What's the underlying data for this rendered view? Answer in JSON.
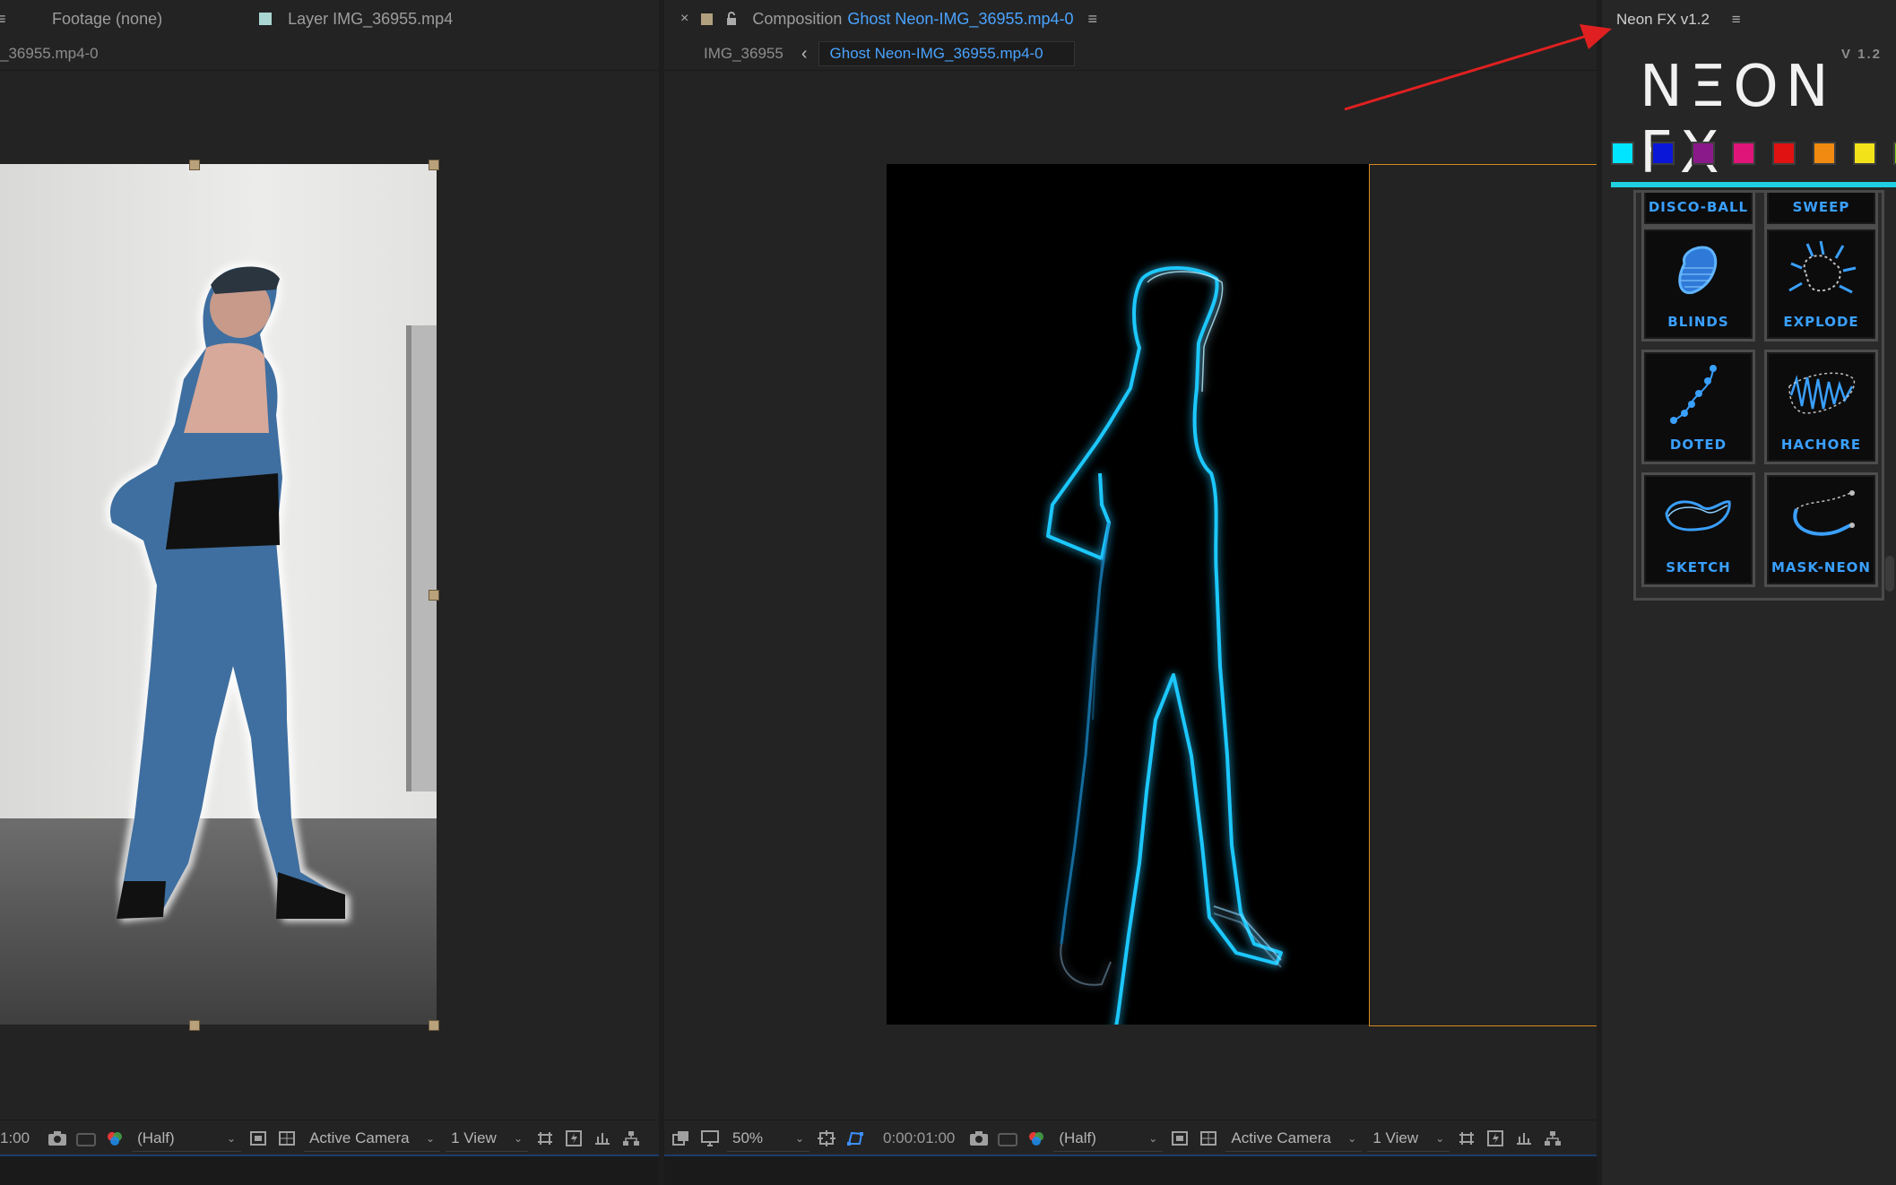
{
  "left_panel": {
    "tab_footage": "Footage  (none)",
    "tab_layer": "Layer  IMG_36955.mp4",
    "subtitle": "_36955.mp4-0",
    "footer_time": "1:00",
    "footer_resolution": "(Half)",
    "footer_camera": "Active Camera",
    "footer_view": "1 View"
  },
  "comp_panel": {
    "close": "×",
    "tab_prefix": "Composition",
    "tab_name": "Ghost Neon-IMG_36955.mp4-0",
    "breadcrumb_parent": "IMG_36955",
    "breadcrumb_arrow": "‹",
    "breadcrumb_current": "Ghost Neon-IMG_36955.mp4-0",
    "footer_zoom": "50%",
    "footer_time": "0:00:01:00",
    "footer_resolution": "(Half)",
    "footer_camera": "Active Camera",
    "footer_view": "1 View"
  },
  "neon_panel": {
    "title": "Neon FX v1.2",
    "logo": "NΞON FX",
    "version": "V 1.2",
    "swatches": [
      "#00e5ff",
      "#0a17d8",
      "#8a1a8a",
      "#e0157a",
      "#e01212",
      "#f08a10",
      "#f2e21a",
      "#7ccc12"
    ],
    "accent_color": "#1fd0e0",
    "effects": [
      {
        "label": "DISCO-BALL",
        "icon": "disco-ball-icon"
      },
      {
        "label": "SWEEP",
        "icon": "sweep-icon"
      },
      {
        "label": "BLINDS",
        "icon": "blinds-icon"
      },
      {
        "label": "EXPLODE",
        "icon": "explode-icon"
      },
      {
        "label": "DOTED",
        "icon": "doted-icon"
      },
      {
        "label": "HACHORE",
        "icon": "hachore-icon"
      },
      {
        "label": "SKETCH",
        "icon": "sketch-icon"
      },
      {
        "label": "MASK-NEON",
        "icon": "mask-neon-icon"
      }
    ]
  }
}
